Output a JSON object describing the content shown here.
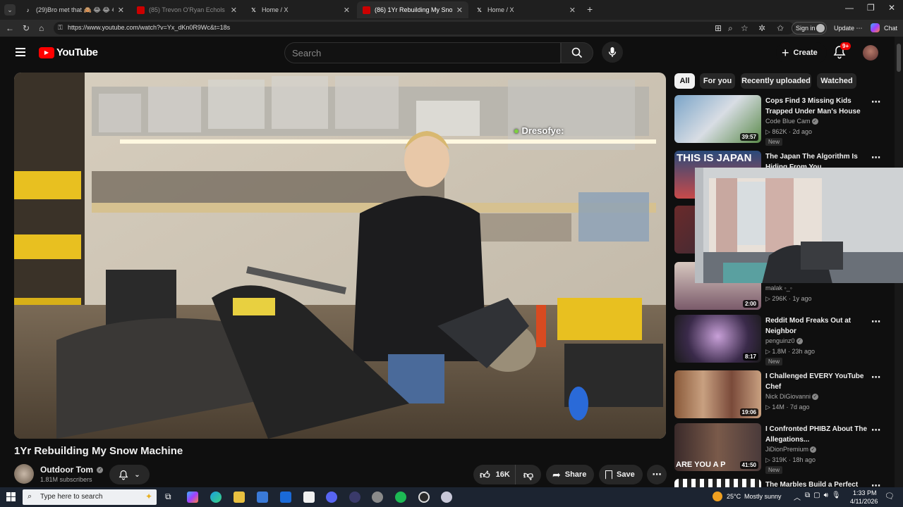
{
  "browser": {
    "tabs": [
      {
        "label": "(29)Bro met that 🙈 😂 😂 😂 #fy",
        "icon": "tiktok-icon"
      },
      {
        "label": "(85) Trevon O'Ryan Echols - YouTu",
        "icon": "youtube-icon"
      },
      {
        "label": "Home / X",
        "icon": "x-icon"
      },
      {
        "label": "(86) 1Yr Rebuilding My Snow Mach",
        "icon": "youtube-icon"
      },
      {
        "label": "Home / X",
        "icon": "x-icon"
      }
    ],
    "active_tab": 3,
    "url": "https://www.youtube.com/watch?v=Yx_dKn0R9Wc&t=18s",
    "sign_in": "Sign in",
    "update": "Update",
    "chat": "Chat"
  },
  "youtube": {
    "logo_text": "YouTube",
    "search_placeholder": "Search",
    "create_label": "Create",
    "notifications_badge": "9+",
    "chips": [
      "All",
      "For you",
      "Recently uploaded",
      "Watched"
    ],
    "video_overlay_text": "Dresofye:",
    "video": {
      "title": "1Yr Rebuilding My Snow Machine",
      "channel": "Outdoor Tom",
      "subscribers": "1.81M subscribers",
      "likes": "16K",
      "share": "Share",
      "save": "Save"
    },
    "recommendations": [
      {
        "title": "Cops Find 3 Missing Kids Trapped Under Man's House",
        "channel": "Code Blue Cam",
        "views": "862K",
        "age": "2d ago",
        "duration": "39:57",
        "badge": "New",
        "verified": true
      },
      {
        "title": "The Japan The Algorithm Is Hiding From You",
        "channel": "",
        "views": "",
        "age": "",
        "duration": "",
        "badge": "",
        "thumb_text": "THIS IS JAPAN"
      },
      {
        "title": "",
        "channel": "",
        "views": "",
        "age": "",
        "duration": "",
        "badge": ""
      },
      {
        "title": "",
        "channel": "malak ◦_◦",
        "views": "296K",
        "age": "1y ago",
        "duration": "2:00",
        "badge": ""
      },
      {
        "title": "Reddit Mod Freaks Out at Neighbor",
        "channel": "penguinz0",
        "views": "1.8M",
        "age": "23h ago",
        "duration": "8:17",
        "badge": "New",
        "verified": true
      },
      {
        "title": "I Challenged EVERY YouTube Chef",
        "channel": "Nick DiGiovanni",
        "views": "14M",
        "age": "7d ago",
        "duration": "19:06",
        "badge": "",
        "verified": true
      },
      {
        "title": "I Confronted PHIBZ About The Allegations...",
        "channel": "JiDionPremium",
        "views": "319K",
        "age": "18h ago",
        "duration": "41:50",
        "badge": "New",
        "verified": true,
        "thumb_text": "ARE YOU A P"
      },
      {
        "title": "The Marbles Build a Perfect",
        "channel": "",
        "views": "",
        "age": "",
        "duration": "",
        "badge": ""
      }
    ]
  },
  "taskbar": {
    "search_placeholder": "Type here to search",
    "weather": "25°C",
    "weather_desc": "Mostly sunny",
    "time": "1:33 PM",
    "date": "4/11/2026"
  }
}
